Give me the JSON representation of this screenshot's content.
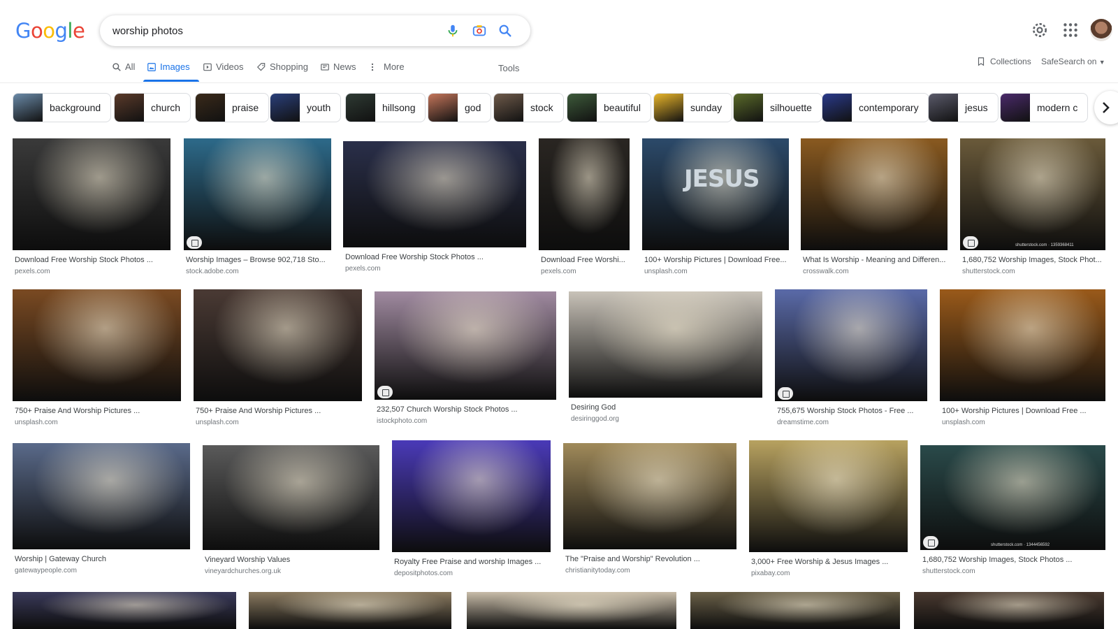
{
  "logo": {
    "text": "Google",
    "letters": [
      {
        "ch": "G",
        "color": "#4285F4"
      },
      {
        "ch": "o",
        "color": "#EA4335"
      },
      {
        "ch": "o",
        "color": "#FBBC05"
      },
      {
        "ch": "g",
        "color": "#4285F4"
      },
      {
        "ch": "l",
        "color": "#34A853"
      },
      {
        "ch": "e",
        "color": "#EA4335"
      }
    ]
  },
  "search": {
    "value": "worship photos"
  },
  "header": {
    "settings_icon": "gear-icon",
    "apps_icon": "apps-grid-icon",
    "account": "account-avatar"
  },
  "nav": {
    "tabs": [
      {
        "label": "All",
        "icon": "search-icon"
      },
      {
        "label": "Images",
        "icon": "image-icon",
        "active": true
      },
      {
        "label": "Videos",
        "icon": "play-icon"
      },
      {
        "label": "Shopping",
        "icon": "tag-icon"
      },
      {
        "label": "News",
        "icon": "news-icon"
      },
      {
        "label": "More",
        "icon": "more-vert-icon"
      }
    ],
    "tools": "Tools",
    "collections": "Collections",
    "safesearch": "SafeSearch on"
  },
  "chips": [
    {
      "label": "background",
      "color": "#6a8aa8"
    },
    {
      "label": "church",
      "color": "#5a3a2a"
    },
    {
      "label": "praise",
      "color": "#3a2a1a"
    },
    {
      "label": "youth",
      "color": "#2a3f7a"
    },
    {
      "label": "hillsong",
      "color": "#2e3a33"
    },
    {
      "label": "god",
      "color": "#c4755a"
    },
    {
      "label": "stock",
      "color": "#6e5a4a"
    },
    {
      "label": "beautiful",
      "color": "#3d5a3a"
    },
    {
      "label": "sunday",
      "color": "#e8b52a"
    },
    {
      "label": "silhouette",
      "color": "#5a6a2a"
    },
    {
      "label": "contemporary",
      "color": "#2a3a8a"
    },
    {
      "label": "jesus",
      "color": "#5a5a6a"
    },
    {
      "label": "modern c",
      "color": "#4a2a6a"
    }
  ],
  "results": [
    {
      "title": "Download Free Worship Stock Photos ...",
      "source": "pexels.com",
      "bg": "#3a3a3a",
      "badge": false
    },
    {
      "title": "Worship Images – Browse 902,718 Sto...",
      "source": "stock.adobe.com",
      "bg": "#2d6a8a",
      "badge": true
    },
    {
      "title": "Download Free Worship Stock Photos ...",
      "source": "pexels.com",
      "bg": "#2a2f4a",
      "badge": false
    },
    {
      "title": "Download Free Worshi...",
      "source": "pexels.com",
      "bg": "#2a2622",
      "badge": false
    },
    {
      "title": "100+ Worship Pictures | Download Free...",
      "source": "unsplash.com",
      "bg": "#2c4a6a",
      "badge": false,
      "overlay": "JESUS"
    },
    {
      "title": "What Is Worship - Meaning and Differen...",
      "source": "crosswalk.com",
      "bg": "#8a5a20",
      "badge": false
    },
    {
      "title": "1,680,752 Worship Images, Stock Phot...",
      "source": "shutterstock.com",
      "bg": "#6a5a3a",
      "badge": true,
      "watermark": "shutterstock.com · 1359368411"
    },
    {
      "title": "750+ Praise And Worship Pictures ...",
      "source": "unsplash.com",
      "bg": "#7a4a22",
      "badge": false
    },
    {
      "title": "750+ Praise And Worship Pictures ...",
      "source": "unsplash.com",
      "bg": "#4a3a34",
      "badge": false
    },
    {
      "title": "232,507 Church Worship Stock Photos ...",
      "source": "istockphoto.com",
      "bg": "#a08aa0",
      "badge": true
    },
    {
      "title": "Desiring God",
      "source": "desiringgod.org",
      "bg": "#c8c2b8",
      "badge": false
    },
    {
      "title": "755,675 Worship Stock Photos - Free ...",
      "source": "dreamstime.com",
      "bg": "#5a6aa8",
      "badge": true
    },
    {
      "title": "100+ Worship Pictures | Download Free ...",
      "source": "unsplash.com",
      "bg": "#9a5a1a",
      "badge": false
    },
    {
      "title": "Worship | Gateway Church",
      "source": "gatewaypeople.com",
      "bg": "#5a6a8a",
      "badge": false
    },
    {
      "title": "Vineyard Worship Values",
      "source": "vineyardchurches.org.uk",
      "bg": "#5a5a5a",
      "badge": false
    },
    {
      "title": "Royalty Free Praise and worship Images ...",
      "source": "depositphotos.com",
      "bg": "#4a3ab8",
      "badge": false
    },
    {
      "title": "The \"Praise and Worship\" Revolution ...",
      "source": "christianitytoday.com",
      "bg": "#a08a5a",
      "badge": false
    },
    {
      "title": "3,000+ Free Worship & Jesus Images ...",
      "source": "pixabay.com",
      "bg": "#b8a260",
      "badge": false
    },
    {
      "title": "1,680,752 Worship Images, Stock Photos ...",
      "source": "shutterstock.com",
      "bg": "#2a4a4a",
      "badge": true,
      "watermark": "shutterstock.com · 1344456592"
    },
    {
      "title": "",
      "source": "",
      "bg": "#3a3a5a",
      "badge": false
    },
    {
      "title": "",
      "source": "",
      "bg": "#8a7a60",
      "badge": false
    },
    {
      "title": "",
      "source": "",
      "bg": "#c8bca8",
      "badge": false
    },
    {
      "title": "",
      "source": "",
      "bg": "#6a6048",
      "badge": false
    },
    {
      "title": "",
      "source": "",
      "bg": "#4a3a30",
      "badge": false
    }
  ]
}
